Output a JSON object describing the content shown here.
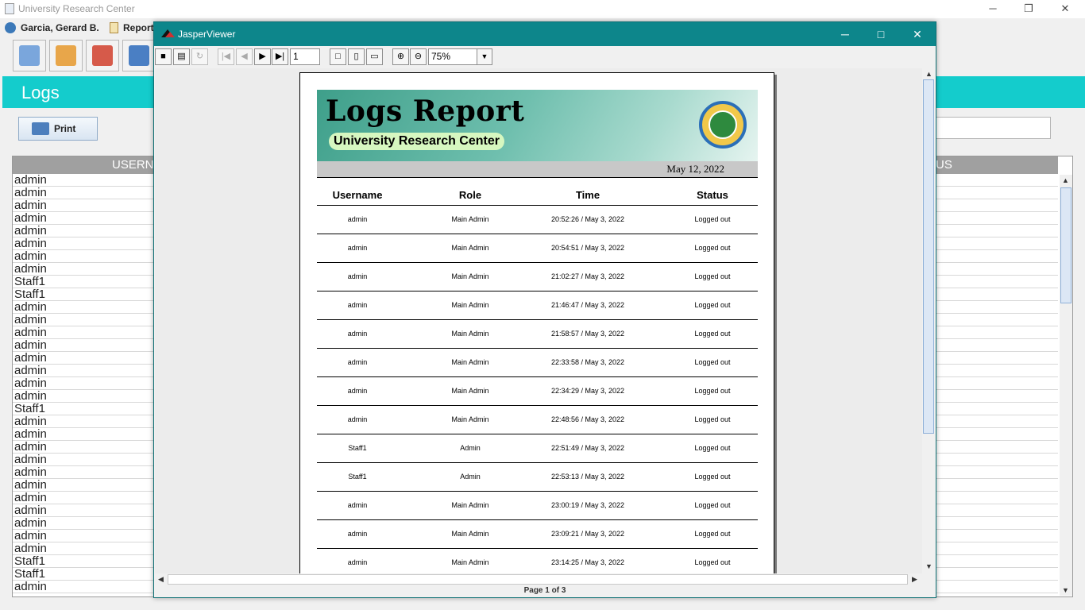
{
  "app": {
    "title": "University Research Center",
    "user_name": "Garcia, Gerard B.",
    "reports_menu": "Report",
    "section_title": "Logs",
    "print_label": "Print",
    "table": {
      "col_username": "USERN",
      "col_status": "US",
      "usernames": [
        "admin",
        "admin",
        "admin",
        "admin",
        "admin",
        "admin",
        "admin",
        "admin",
        "Staff1",
        "Staff1",
        "admin",
        "admin",
        "admin",
        "admin",
        "admin",
        "admin",
        "admin",
        "admin",
        "Staff1",
        "admin",
        "admin",
        "admin",
        "admin",
        "admin",
        "admin",
        "admin",
        "admin",
        "admin",
        "admin",
        "admin",
        "Staff1",
        "Staff1",
        "admin"
      ]
    }
  },
  "window_controls": {
    "minimize": "─",
    "maximize": "□",
    "restore": "❐",
    "close": "✕"
  },
  "viewer": {
    "title": "JasperViewer",
    "page_number": "1",
    "zoom": "75%",
    "status": "Page 1 of 3",
    "toolbar_icons": [
      "save-icon",
      "print-icon",
      "reload-icon",
      "first-page-icon",
      "previous-page-icon",
      "next-page-icon",
      "last-page-icon",
      "actual-size-icon",
      "fit-page-icon",
      "fit-width-icon",
      "zoom-in-icon",
      "zoom-out-icon"
    ]
  },
  "report": {
    "title": "Logs Report",
    "subtitle": "University Research Center",
    "date": "May 12, 2022",
    "headers": [
      "Username",
      "Role",
      "Time",
      "Status"
    ],
    "rows": [
      [
        "admin",
        "Main Admin",
        "20:52:26 / May 3, 2022",
        "Logged out"
      ],
      [
        "admin",
        "Main Admin",
        "20:54:51 / May 3, 2022",
        "Logged out"
      ],
      [
        "admin",
        "Main Admin",
        "21:02:27 / May 3, 2022",
        "Logged out"
      ],
      [
        "admin",
        "Main Admin",
        "21:46:47 / May 3, 2022",
        "Logged out"
      ],
      [
        "admin",
        "Main Admin",
        "21:58:57 / May 3, 2022",
        "Logged out"
      ],
      [
        "admin",
        "Main Admin",
        "22:33:58 / May 3, 2022",
        "Logged out"
      ],
      [
        "admin",
        "Main Admin",
        "22:34:29 / May 3, 2022",
        "Logged out"
      ],
      [
        "admin",
        "Main Admin",
        "22:48:56 / May 3, 2022",
        "Logged out"
      ],
      [
        "Staff1",
        "Admin",
        "22:51:49 / May 3, 2022",
        "Logged out"
      ],
      [
        "Staff1",
        "Admin",
        "22:53:13 / May 3, 2022",
        "Logged out"
      ],
      [
        "admin",
        "Main Admin",
        "23:00:19 / May 3, 2022",
        "Logged out"
      ],
      [
        "admin",
        "Main Admin",
        "23:09:21 / May 3, 2022",
        "Logged out"
      ],
      [
        "admin",
        "Main Admin",
        "23:14:25 / May 3, 2022",
        "Logged out"
      ]
    ]
  },
  "colors": {
    "teal_titlebar": "#0d868b",
    "header_band": "#14cccc"
  }
}
